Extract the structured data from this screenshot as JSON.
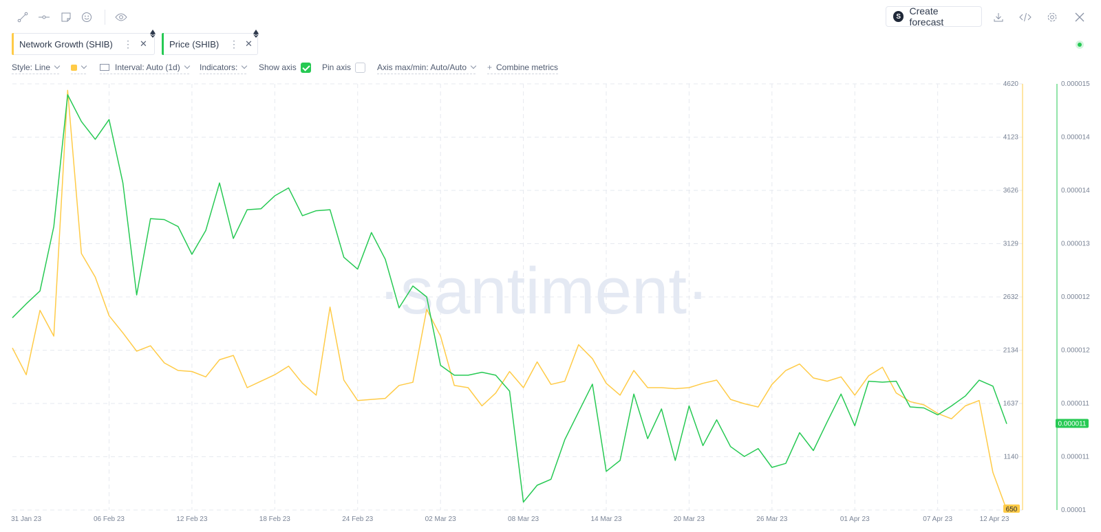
{
  "toolbar": {
    "left_icons": [
      "line-draw-icon",
      "horizontal-line-icon",
      "note-icon",
      "emoji-icon",
      "eye-icon"
    ],
    "forecast_label": "Create forecast",
    "right_icons": [
      "download-icon",
      "embed-code-icon",
      "settings-gear-icon",
      "close-icon"
    ]
  },
  "metrics": [
    {
      "label": "Network Growth (SHIB)",
      "color": "#ffcb47"
    },
    {
      "label": "Price (SHIB)",
      "color": "#26c953"
    }
  ],
  "settings": {
    "style": "Style: Line",
    "interval": "Interval: Auto (1d)",
    "indicators": "Indicators:",
    "show_axis": "Show axis",
    "show_axis_checked": true,
    "pin_axis": "Pin axis",
    "pin_axis_checked": false,
    "axis_maxmin": "Axis max/min: Auto/Auto",
    "combine": "Combine metrics"
  },
  "watermark": "·santiment·",
  "chart_data": {
    "type": "line",
    "x": [
      "30 Jan 23",
      "31 Jan 23",
      "01 Feb 23",
      "02 Feb 23",
      "03 Feb 23",
      "04 Feb 23",
      "05 Feb 23",
      "06 Feb 23",
      "07 Feb 23",
      "08 Feb 23",
      "09 Feb 23",
      "10 Feb 23",
      "11 Feb 23",
      "12 Feb 23",
      "13 Feb 23",
      "14 Feb 23",
      "15 Feb 23",
      "16 Feb 23",
      "17 Feb 23",
      "18 Feb 23",
      "19 Feb 23",
      "20 Feb 23",
      "21 Feb 23",
      "22 Feb 23",
      "23 Feb 23",
      "24 Feb 23",
      "25 Feb 23",
      "26 Feb 23",
      "27 Feb 23",
      "28 Feb 23",
      "01 Mar 23",
      "02 Mar 23",
      "03 Mar 23",
      "04 Mar 23",
      "05 Mar 23",
      "06 Mar 23",
      "07 Mar 23",
      "08 Mar 23",
      "09 Mar 23",
      "10 Mar 23",
      "11 Mar 23",
      "12 Mar 23",
      "13 Mar 23",
      "14 Mar 23",
      "15 Mar 23",
      "16 Mar 23",
      "17 Mar 23",
      "18 Mar 23",
      "19 Mar 23",
      "20 Mar 23",
      "21 Mar 23",
      "22 Mar 23",
      "23 Mar 23",
      "24 Mar 23",
      "25 Mar 23",
      "26 Mar 23",
      "27 Mar 23",
      "28 Mar 23",
      "29 Mar 23",
      "30 Mar 23",
      "31 Mar 23",
      "01 Apr 23",
      "02 Apr 23",
      "03 Apr 23",
      "04 Apr 23",
      "05 Apr 23",
      "06 Apr 23",
      "07 Apr 23",
      "08 Apr 23",
      "09 Apr 23",
      "10 Apr 23",
      "11 Apr 23",
      "12 Apr 23"
    ],
    "x_tick_labels": [
      "31 Jan 23",
      "06 Feb 23",
      "12 Feb 23",
      "18 Feb 23",
      "24 Feb 23",
      "02 Mar 23",
      "08 Mar 23",
      "14 Mar 23",
      "20 Mar 23",
      "26 Mar 23",
      "01 Apr 23",
      "07 Apr 23",
      "12 Apr 23"
    ],
    "series": [
      {
        "name": "Network Growth (SHIB)",
        "color": "#ffcb47",
        "axis": "left",
        "values": [
          2160,
          1910,
          2510,
          2270,
          4560,
          3040,
          2820,
          2460,
          2300,
          2130,
          2180,
          2020,
          1950,
          1940,
          1890,
          2050,
          2090,
          1790,
          1850,
          1910,
          1990,
          1830,
          1720,
          2540,
          1860,
          1670,
          1680,
          1690,
          1810,
          1840,
          2520,
          2270,
          1810,
          1790,
          1620,
          1740,
          1940,
          1790,
          2030,
          1820,
          1850,
          2190,
          2060,
          1830,
          1720,
          1950,
          1790,
          1790,
          1780,
          1790,
          1830,
          1860,
          1680,
          1640,
          1610,
          1820,
          1950,
          2010,
          1880,
          1850,
          1890,
          1720,
          1900,
          1980,
          1740,
          1660,
          1630,
          1550,
          1500,
          1620,
          1670,
          1000,
          650
        ]
      },
      {
        "name": "Price (SHIB)",
        "color": "#26c953",
        "axis": "right",
        "values": [
          1.21e-05,
          1.224e-05,
          1.237e-05,
          1.302e-05,
          1.435e-05,
          1.408e-05,
          1.39e-05,
          1.41e-05,
          1.346e-05,
          1.233e-05,
          1.31e-05,
          1.309e-05,
          1.302e-05,
          1.274e-05,
          1.298e-05,
          1.346e-05,
          1.29e-05,
          1.319e-05,
          1.32e-05,
          1.333e-05,
          1.341e-05,
          1.313e-05,
          1.318e-05,
          1.319e-05,
          1.271e-05,
          1.259e-05,
          1.296e-05,
          1.269e-05,
          1.22e-05,
          1.242e-05,
          1.231e-05,
          1.162e-05,
          1.152e-05,
          1.152e-05,
          1.155e-05,
          1.152e-05,
          1.136e-05,
          1.024e-05,
          1.041e-05,
          1.047e-05,
          1.087e-05,
          1.115e-05,
          1.143e-05,
          1.055e-05,
          1.066e-05,
          1.133e-05,
          1.088e-05,
          1.118e-05,
          1.066e-05,
          1.121e-05,
          1.081e-05,
          1.107e-05,
          1.08e-05,
          1.07e-05,
          1.078e-05,
          1.059e-05,
          1.063e-05,
          1.094e-05,
          1.076e-05,
          1.105e-05,
          1.133e-05,
          1.101e-05,
          1.146e-05,
          1.145e-05,
          1.146e-05,
          1.12e-05,
          1.119e-05,
          1.112e-05,
          1.121e-05,
          1.131e-05,
          1.147e-05,
          1.141e-05,
          1.103e-05
        ]
      }
    ],
    "left_axis": {
      "ticks": [
        "4620",
        "4123",
        "3626",
        "3129",
        "2632",
        "2134",
        "1637",
        "1140"
      ],
      "min": 650,
      "max": 4620,
      "current": "650"
    },
    "right_axis": {
      "ticks": [
        "0.000015",
        "0.000014",
        "0.000014",
        "0.000013",
        "0.000012",
        "0.000012",
        "0.000011",
        "0.000011",
        "0.00001"
      ],
      "min": 1.016e-05,
      "max": 1.446e-05,
      "current": "0.000011"
    },
    "grid": true
  }
}
